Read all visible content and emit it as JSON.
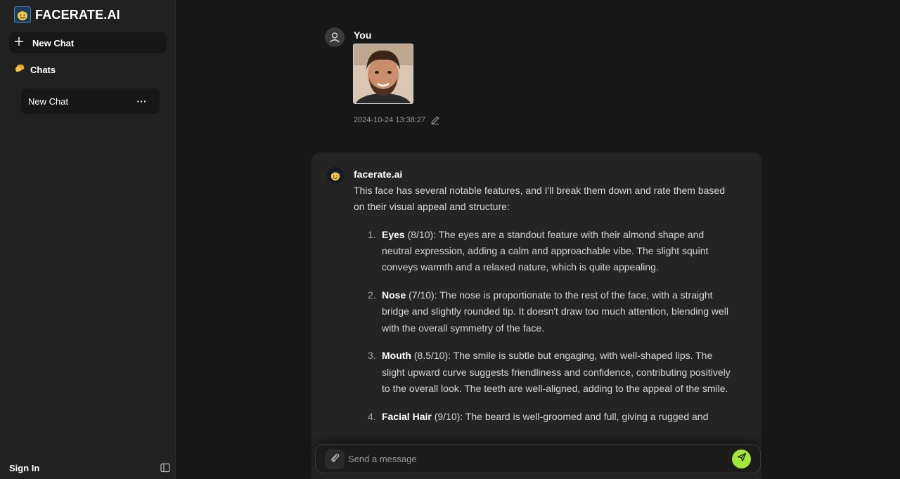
{
  "app": {
    "brand": "FACERATE.AI"
  },
  "sidebar": {
    "new_chat_label": "New Chat",
    "chats_label": "Chats",
    "chat_items": [
      {
        "label": "New Chat",
        "menu": "···"
      }
    ],
    "sign_in_label": "Sign In"
  },
  "conversation": {
    "user": {
      "name": "You",
      "timestamp": "2024-10-24 13:38:27"
    },
    "bot": {
      "name": "facerate.ai",
      "intro": "This face has several notable features, and I'll break them down and rate them based on their visual appeal and structure:",
      "items": [
        {
          "num": "1.",
          "title": "Eyes",
          "rating": " (8/10)",
          "text": ": The eyes are a standout feature with their almond shape and neutral expression, adding a calm and approachable vibe. The slight squint conveys warmth and a relaxed nature, which is quite appealing."
        },
        {
          "num": "2.",
          "title": "Nose",
          "rating": " (7/10)",
          "text": ": The nose is proportionate to the rest of the face, with a straight bridge and slightly rounded tip. It doesn't draw too much attention, blending well with the overall symmetry of the face."
        },
        {
          "num": "3.",
          "title": "Mouth",
          "rating": " (8.5/10)",
          "text": ": The smile is subtle but engaging, with well-shaped lips. The slight upward curve suggests friendliness and confidence, contributing positively to the overall look. The teeth are well-aligned, adding to the appeal of the smile."
        },
        {
          "num": "4.",
          "title": "Facial Hair",
          "rating": " (9/10)",
          "text": ": The beard is well-groomed and full, giving a rugged and"
        }
      ]
    }
  },
  "composer": {
    "placeholder": "Send a message"
  },
  "colors": {
    "accent": "#a3e635",
    "sidebar_bg": "#212121",
    "main_bg": "#171717",
    "card_bg": "#242424"
  }
}
